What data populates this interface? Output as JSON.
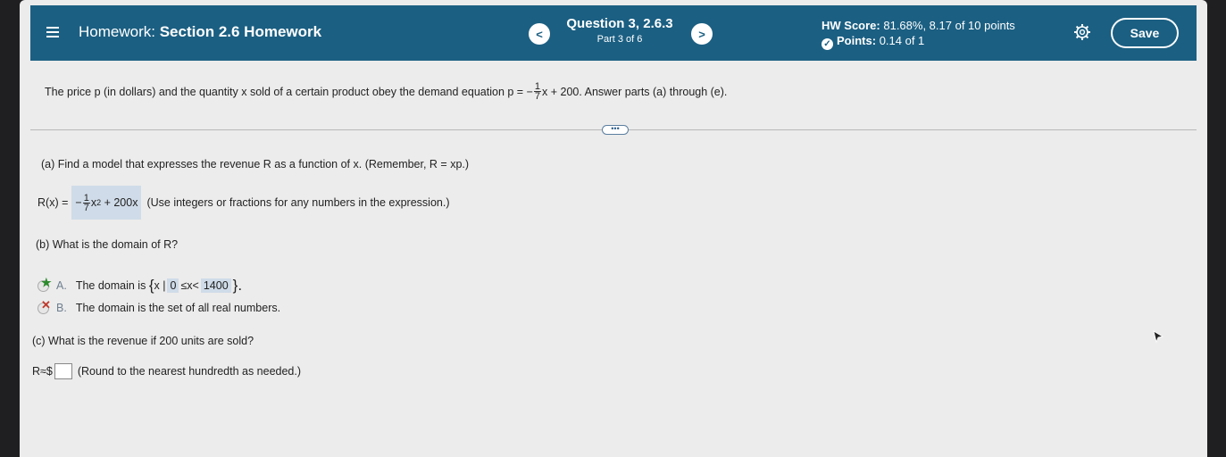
{
  "header": {
    "title_prefix": "Homework:",
    "title_main": "Section 2.6 Homework",
    "question_title": "Question 3, 2.6.3",
    "question_part": "Part 3 of 6",
    "prev_label": "<",
    "next_label": ">",
    "hw_score_label": "HW Score:",
    "hw_score_value": "81.68%, 8.17 of 10 points",
    "points_label": "Points:",
    "points_value": "0.14 of 1",
    "save_label": "Save"
  },
  "problem": {
    "intro": "The price p (in dollars) and the quantity x sold of a certain product obey the demand equation p = −",
    "frac_num": "1",
    "frac_den": "7",
    "tail": "x + 200. Answer parts (a) through (e)."
  },
  "more_label": "•••",
  "part_a": {
    "question": "(a) Find a model that expresses the revenue R as a function of x. (Remember, R = xp.)",
    "lhs": "R(x) =",
    "answer_prefix": "−",
    "frac_num": "1",
    "frac_den": "7",
    "answer_var": "x",
    "answer_exp": "2",
    "answer_tail": "+ 200x",
    "hint": "(Use integers or fractions for any numbers in the expression.)"
  },
  "part_b": {
    "question": "(b) What is the domain of R?",
    "choice_a_letter": "A.",
    "choice_a_text": "The domain is",
    "set_open": "{",
    "set_expr": "x | ",
    "lower": "0",
    "ineq": "≤x<",
    "upper": "1400",
    "set_close": "}.",
    "choice_b_letter": "B.",
    "choice_b_text": "The domain is the set of all real numbers."
  },
  "part_c": {
    "question": "(c) What is the revenue if 200 units are sold?",
    "lhs": "R≈$",
    "input_value": "",
    "hint": "(Round to the nearest hundredth as needed.)"
  },
  "colors": {
    "header_bg": "#1b5f82",
    "answer_bg": "#cfdbe8",
    "correct": "#2d8a2d",
    "incorrect": "#c0392b"
  }
}
